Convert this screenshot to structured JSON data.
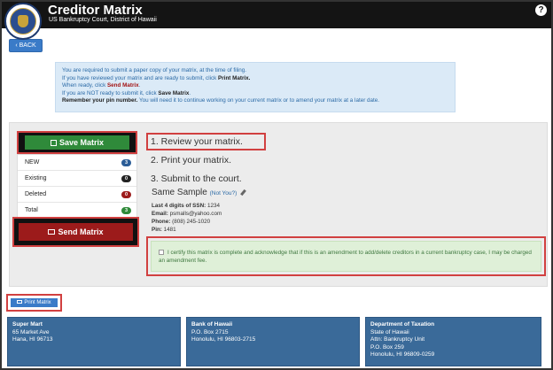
{
  "header": {
    "title": "Creditor Matrix",
    "subtitle": "US Bankruptcy Court, District of Hawaii",
    "help": "?"
  },
  "back_button": "BACK",
  "info": {
    "line1": "You are required to submit a paper copy of your matrix, at the time of filing.",
    "line2_pre": "If you have reviewed your matrix and are ready to submit, click ",
    "line2_bold": "Print Matrix.",
    "line3_pre": "When ready, click ",
    "line3_bold": "Send Matrix",
    "line3_post": ".",
    "line4_pre": "If you are NOT ready to submit it, click ",
    "line4_bold": "Save Matrix",
    "line4_post": ".",
    "line5_bold": "Remember your pin number.",
    "line5_post": " You will need it to continue working on your current matrix or to amend your matrix at a later date."
  },
  "save_matrix": "Save Matrix",
  "counts": [
    {
      "label": "NEW",
      "value": "3",
      "color": "#2b5d97"
    },
    {
      "label": "Existing",
      "value": "0",
      "color": "#222222"
    },
    {
      "label": "Deleted",
      "value": "0",
      "color": "#9c1b1b"
    },
    {
      "label": "Total",
      "value": "3",
      "color": "#2f8a3a"
    }
  ],
  "send_matrix": "Send Matrix",
  "steps": [
    "1. Review your matrix.",
    "2. Print your matrix.",
    "3. Submit to the court."
  ],
  "user": {
    "name": "Same Sample",
    "not_you": "(Not You?)",
    "ssn_label": "Last 4 digits of SSN:",
    "ssn": "1234",
    "email_label": "Email:",
    "email": "psmalls@yahoo.com",
    "phone_label": "Phone:",
    "phone": "(808) 245-1020",
    "pin_label": "Pin:",
    "pin": "1481"
  },
  "certify_text": "I certify this matrix is complete and acknowledge that if this is an amendment to add/delete creditors in a current bankruptcy case, I may be charged an amendment fee.",
  "print_matrix": "Print Matrix",
  "creditors": [
    {
      "name": "Super Mart",
      "lines": [
        "65 Market Ave",
        "Hana, HI 96713"
      ]
    },
    {
      "name": "Bank of Hawaii",
      "lines": [
        "P.O. Box 2715",
        "Honolulu, HI 96803-2715"
      ]
    },
    {
      "name": "Department of Taxation",
      "lines": [
        "State of Hawaii",
        "Attn: Bankruptcy Unit",
        "P.O. Box 259",
        "Honolulu, HI 96809-0259"
      ]
    }
  ]
}
